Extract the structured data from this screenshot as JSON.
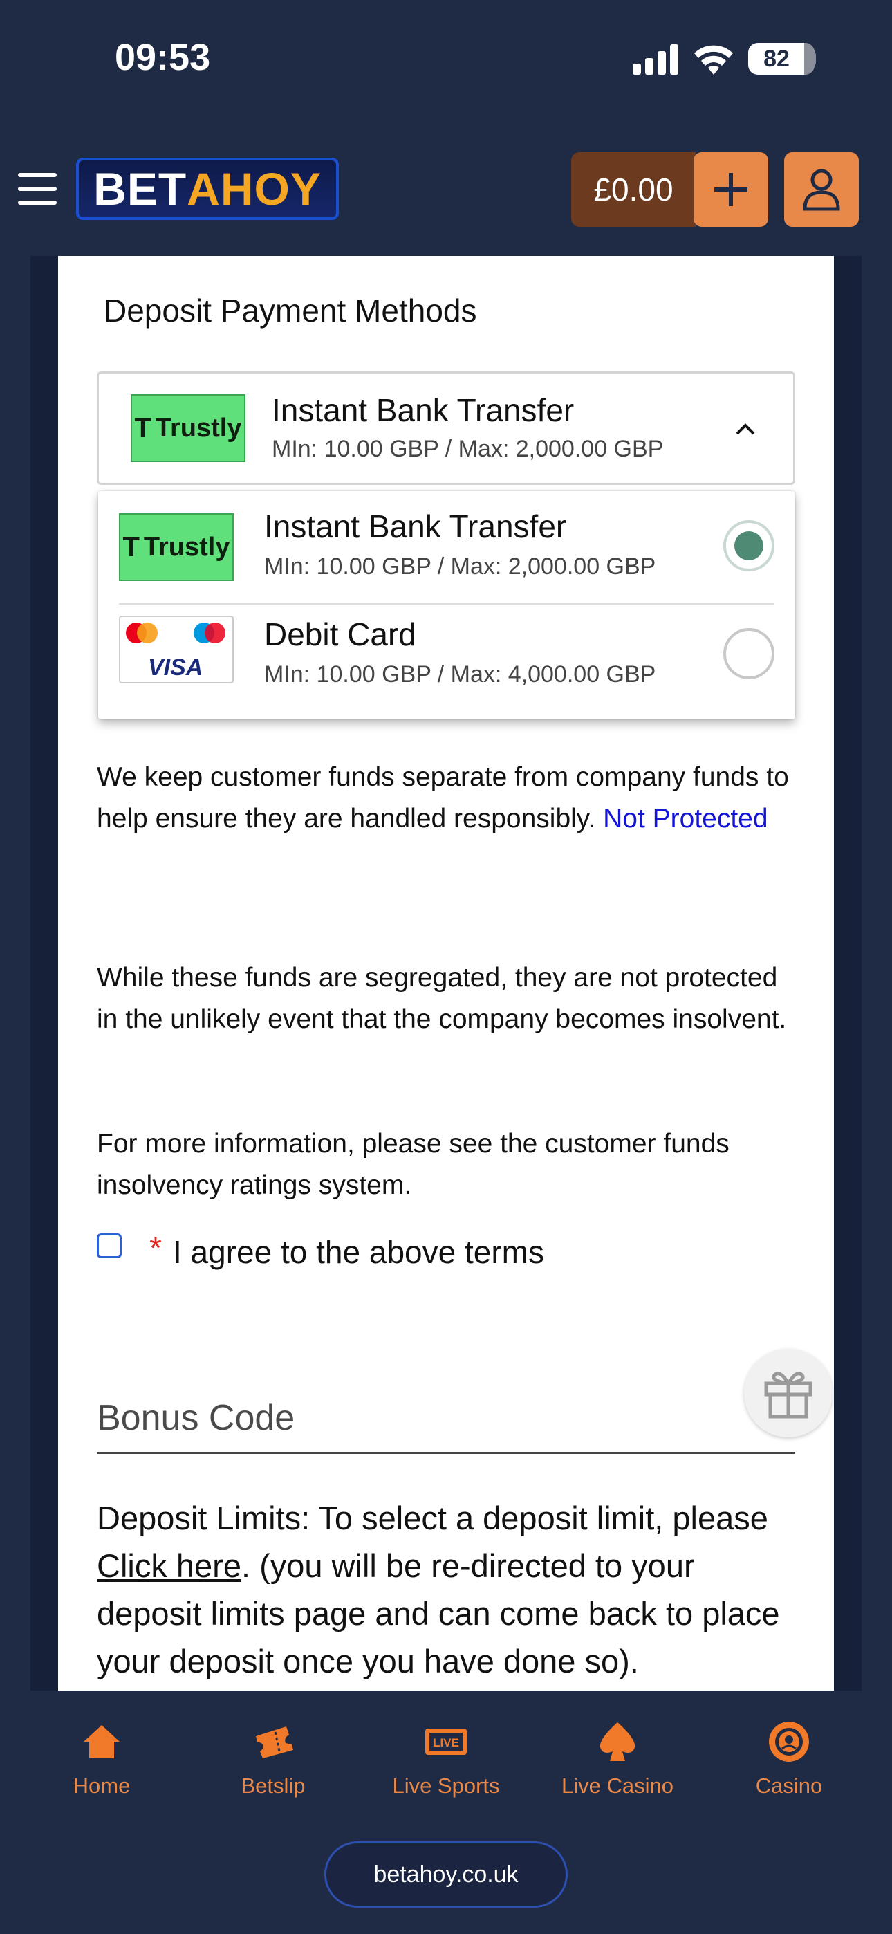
{
  "status_bar": {
    "time": "09:53",
    "battery": "82"
  },
  "header": {
    "logo_bet": "BET",
    "logo_ahoy": "AHOY",
    "balance": "£0.00"
  },
  "deposit": {
    "title": "Deposit Payment Methods",
    "selected": {
      "logo_text": "Trustly",
      "name": "Instant Bank Transfer",
      "limits": "MIn: 10.00 GBP / Max: 2,000.00 GBP"
    },
    "options": [
      {
        "logo_text": "Trustly",
        "name": "Instant Bank Transfer",
        "limits": "MIn: 10.00 GBP / Max: 2,000.00 GBP",
        "checked": true
      },
      {
        "logo_text": "VISA",
        "name": "Debit Card",
        "limits": "MIn: 10.00 GBP / Max: 4,000.00 GBP",
        "checked": false
      }
    ]
  },
  "info": {
    "funds_text": "We keep customer funds separate from company funds to help ensure they are handled responsibly.",
    "funds_link": "Not Protected",
    "segregated_text": "While these funds are segregated, they are not protected in the unlikely event that the company becomes insolvent.",
    "more_info_text": "For more information, please see the customer funds insolvency ratings system."
  },
  "agree": {
    "required_mark": "*",
    "label": "I agree to the above terms"
  },
  "bonus": {
    "label": "Bonus Code"
  },
  "limits": {
    "prefix": "Deposit Limits: To select a deposit limit, please ",
    "link": "Click here",
    "suffix": ". (you will be re-directed to your deposit limits page and can come back to place your deposit once you have done so)."
  },
  "bottom_nav": {
    "items": [
      {
        "label": "Home",
        "icon": "home-icon"
      },
      {
        "label": "Betslip",
        "icon": "ticket-icon"
      },
      {
        "label": "Live Sports",
        "icon": "live-icon",
        "badge": "LIVE"
      },
      {
        "label": "Live Casino",
        "icon": "spade-icon"
      },
      {
        "label": "Casino",
        "icon": "chip-icon"
      }
    ],
    "url": "betahoy.co.uk"
  },
  "colors": {
    "navy": "#1f2a44",
    "accent_orange": "#e8894a",
    "balance_brown": "#6b3a1f",
    "trustly_green": "#5fe07a",
    "radio_green": "#4f8a74",
    "link_blue": "#1414d6"
  }
}
